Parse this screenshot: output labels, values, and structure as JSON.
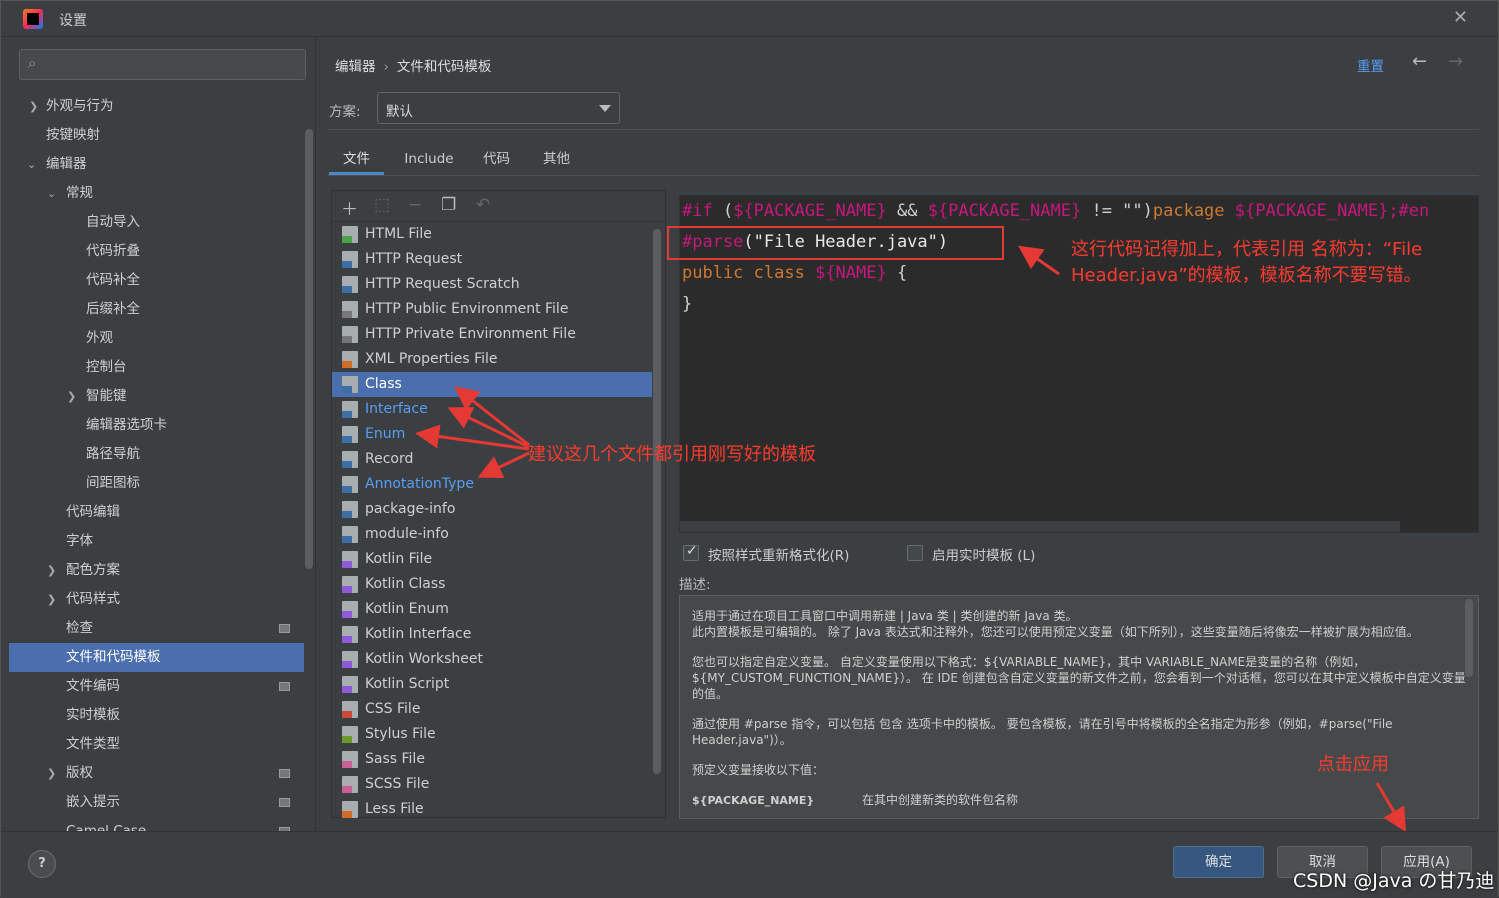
{
  "window": {
    "title": "设置"
  },
  "breadcrumb": {
    "parent": "编辑器",
    "current": "文件和代码模板"
  },
  "header": {
    "reset_label": "重置"
  },
  "scheme": {
    "label": "方案:",
    "value": "默认"
  },
  "tabs": [
    {
      "label": "文件"
    },
    {
      "label": "Include"
    },
    {
      "label": "代码"
    },
    {
      "label": "其他"
    }
  ],
  "sidebar": {
    "items": [
      {
        "label": "外观与行为"
      },
      {
        "label": "按键映射"
      },
      {
        "label": "编辑器"
      },
      {
        "label": "常规"
      },
      {
        "label": "自动导入"
      },
      {
        "label": "代码折叠"
      },
      {
        "label": "代码补全"
      },
      {
        "label": "后缀补全"
      },
      {
        "label": "外观"
      },
      {
        "label": "控制台"
      },
      {
        "label": "智能键"
      },
      {
        "label": "编辑器选项卡"
      },
      {
        "label": "路径导航"
      },
      {
        "label": "间距图标"
      },
      {
        "label": "代码编辑"
      },
      {
        "label": "字体"
      },
      {
        "label": "配色方案"
      },
      {
        "label": "代码样式"
      },
      {
        "label": "检查"
      },
      {
        "label": "文件和代码模板"
      },
      {
        "label": "文件编码"
      },
      {
        "label": "实时模板"
      },
      {
        "label": "文件类型"
      },
      {
        "label": "版权"
      },
      {
        "label": "嵌入提示"
      },
      {
        "label": "Camel Case"
      }
    ]
  },
  "templates": {
    "items": [
      {
        "label": "HTML File"
      },
      {
        "label": "HTTP Request"
      },
      {
        "label": "HTTP Request Scratch"
      },
      {
        "label": "HTTP Public Environment File"
      },
      {
        "label": "HTTP Private Environment File"
      },
      {
        "label": "XML Properties File"
      },
      {
        "label": "Class"
      },
      {
        "label": "Interface"
      },
      {
        "label": "Enum"
      },
      {
        "label": "Record"
      },
      {
        "label": "AnnotationType"
      },
      {
        "label": "package-info"
      },
      {
        "label": "module-info"
      },
      {
        "label": "Kotlin File"
      },
      {
        "label": "Kotlin Class"
      },
      {
        "label": "Kotlin Enum"
      },
      {
        "label": "Kotlin Interface"
      },
      {
        "label": "Kotlin Worksheet"
      },
      {
        "label": "Kotlin Script"
      },
      {
        "label": "CSS File"
      },
      {
        "label": "Stylus File"
      },
      {
        "label": "Sass File"
      },
      {
        "label": "SCSS File"
      },
      {
        "label": "Less File"
      }
    ]
  },
  "editor": {
    "l1_if": "#if",
    "l1_a": " (",
    "l1_v1": "${PACKAGE_NAME}",
    "l1_b": " && ",
    "l1_v2": "${PACKAGE_NAME}",
    "l1_c": " != \"\")",
    "l1_pkg": "package",
    "l1_sp": " ",
    "l1_v3": "${PACKAGE_NAME}",
    "l1_end": ";#en",
    "l2_parse": "#parse",
    "l2_arg": "(\"File Header.java\")",
    "l3_kw": "public class",
    "l3_sp": " ",
    "l3_var": "${NAME}",
    "l3_brace": " {",
    "l4": "}"
  },
  "options": {
    "reformat_label": "按照样式重新格式化(R)",
    "live_templates_label": "启用实时模板 (L)"
  },
  "description": {
    "label": "描述:",
    "p1": "适用于通过在项目工具窗口中调用新建 | Java 类 | 类创建的新 Java 类。",
    "p1b": "此内置模板是可编辑的。 除了 Java 表达式和注释外，您还可以使用预定义变量（如下所列），这些变量随后将像宏一样被扩展为相应值。",
    "p2": "您也可以指定自定义变量。 自定义变量使用以下格式：${VARIABLE_NAME}，其中 VARIABLE_NAME是变量的名称（例如，${MY_CUSTOM_FUNCTION_NAME}）。 在 IDE 创建包含自定义变量的新文件之前，您会看到一个对话框，您可以在其中定义模板中自定义变量的值。",
    "p3": "通过使用 #parse 指令，可以包括 包含 选项卡中的模板。 要包含模板，请在引号中将模板的全名指定为形参（例如，#parse(\"File Header.java\")）。",
    "p4": "预定义变量接收以下值：",
    "var_name": "${PACKAGE_NAME}",
    "var_desc": "在其中创建新类的软件包名称"
  },
  "annotations": {
    "a1_line1": "这行代码记得加上，代表引用 名称为：“File",
    "a1_line2": "Header.java”的模板，模板名称不要写错。",
    "a2": "建议这几个文件都引用刚写好的模板",
    "a3": "点击应用"
  },
  "buttons": {
    "ok": "确定",
    "cancel": "取消",
    "apply": "应用(A)"
  },
  "watermark": "CSDN @Java の甘乃迪",
  "colors": {
    "accent": "#4b6eaf",
    "annotation": "#ff3b30",
    "link": "#589df6"
  }
}
